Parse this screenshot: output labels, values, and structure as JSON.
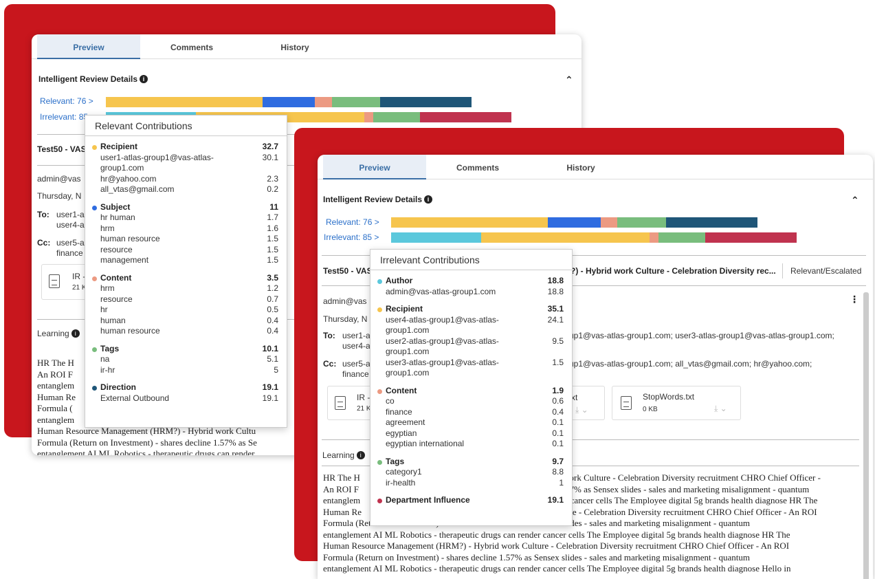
{
  "colors": {
    "accent_red": "#c8161d",
    "link_blue": "#2a6fc9",
    "yellow": "#f6c54e",
    "blue": "#2f6ce0",
    "salmon": "#ec9a82",
    "green": "#79bd7d",
    "navy": "#1f5678",
    "cyan": "#5bc8dc",
    "crimson": "#c0334f"
  },
  "back": {
    "tabs": [
      "Preview",
      "Comments",
      "History"
    ],
    "review_title": "Intelligent Review Details",
    "relevant": "Relevant: 76 >",
    "irrelevant": "Irrelevant: 85 >",
    "subject": "Test50 - VAS",
    "sender": "admin@vas",
    "date": "Thursday, N",
    "to_label": "To:",
    "to_line1": "user1-a",
    "to_line2": "user4-a",
    "cc_label": "Cc:",
    "cc_line1": "user5-a",
    "cc_line2": "finance",
    "attach_name": "IR -",
    "attach_size": "21 K",
    "learning": "Learning",
    "body": [
      "HR The H",
      "An ROI F",
      "entanglem",
      "Human Re",
      "Formula (",
      "entanglem",
      "Human Resource Management (HRM?) - Hybrid work Cultu",
      "Formula (Return on Investment) - shares decline 1.57% as Se",
      "entanglement AI ML Robotics - therapeutic drugs can render"
    ],
    "popup": {
      "title": "Relevant Contributions",
      "groups": [
        {
          "name": "Recipient",
          "value": "32.7",
          "color": "#f6c54e",
          "items": [
            {
              "label": "user1-atlas-group1@vas-atlas-",
              "value": "30.1"
            },
            {
              "label": "group1.com",
              "value": ""
            },
            {
              "label": "hr@yahoo.com",
              "value": "2.3"
            },
            {
              "label": "all_vtas@gmail.com",
              "value": "0.2"
            }
          ]
        },
        {
          "name": "Subject",
          "value": "11",
          "color": "#2f6ce0",
          "items": [
            {
              "label": "hr human",
              "value": "1.7"
            },
            {
              "label": "hrm",
              "value": "1.6"
            },
            {
              "label": "human resource",
              "value": "1.5"
            },
            {
              "label": "resource",
              "value": "1.5"
            },
            {
              "label": "management",
              "value": "1.5"
            }
          ]
        },
        {
          "name": "Content",
          "value": "3.5",
          "color": "#ec9a82",
          "items": [
            {
              "label": "hrm",
              "value": "1.2"
            },
            {
              "label": "resource",
              "value": "0.7"
            },
            {
              "label": "hr",
              "value": "0.5"
            },
            {
              "label": "human",
              "value": "0.4"
            },
            {
              "label": "human resource",
              "value": "0.4"
            }
          ]
        },
        {
          "name": "Tags",
          "value": "10.1",
          "color": "#79bd7d",
          "items": [
            {
              "label": "na",
              "value": "5.1"
            },
            {
              "label": "ir-hr",
              "value": "5"
            }
          ]
        },
        {
          "name": "Direction",
          "value": "19.1",
          "color": "#1f5678",
          "items": [
            {
              "label": "External Outbound",
              "value": "19.1"
            }
          ]
        }
      ]
    }
  },
  "front": {
    "tabs": [
      "Preview",
      "Comments",
      "History"
    ],
    "review_title": "Intelligent Review Details",
    "relevant": "Relevant: 76 >",
    "irrelevant": "Irrelevant: 85 >",
    "subject_left": "Test50 - VAS",
    "subject_right": "?) - Hybrid work Culture - Celebration Diversity rec...",
    "status": "Relevant/Escalated",
    "more_icon": "⋮",
    "sender": "admin@vas",
    "date": "Thursday, N",
    "to_label": "To:",
    "to_line1": "user1-a",
    "to_line2": "user4-a",
    "to_right": "up1@vas-atlas-group1.com; user3-atlas-group1@vas-atlas-group1.com;",
    "cc_label": "Cc:",
    "cc_line1": "user5-a",
    "cc_line2": "finance",
    "cc_right": "up1@vas-atlas-group1.com; all_vtas@gmail.com; hr@yahoo.com;",
    "attach1_name": "IR -",
    "attach1_size": "21 K",
    "attach2_name": "xt",
    "attach3_name": "StopWords.txt",
    "attach3_size": "0 KB",
    "learning": "Learning",
    "body_left": [
      "HR The H",
      "An ROI F",
      "entanglem",
      "Human Re"
    ],
    "body_right": [
      "vork Culture - Celebration Diversity recruitment CHRO Chief Officer -",
      "57% as Sensex slides - sales and marketing misalignment - quantum",
      "r cancer cells The Employee digital 5g brands health diagnose HR The",
      "ure - Celebration Diversity recruitment CHRO Chief Officer - An ROI"
    ],
    "body_full": [
      "Formula (Return on Investment) - shares decline 1.57% as Sensex slides - sales and marketing misalignment - quantum",
      "entanglement AI ML Robotics - therapeutic drugs can render cancer cells The Employee digital 5g brands health diagnose HR The",
      "Human Resource Management (HRM?) - Hybrid work Culture - Celebration Diversity recruitment CHRO Chief Officer - An ROI",
      "Formula (Return on Investment) - shares decline 1.57% as Sensex slides - sales and marketing misalignment - quantum",
      "entanglement AI ML Robotics - therapeutic drugs can render cancer cells The Employee digital 5g brands health diagnose Hello in"
    ],
    "popup": {
      "title": "Irrelevant Contributions",
      "groups": [
        {
          "name": "Author",
          "value": "18.8",
          "color": "#5bc8dc",
          "items": [
            {
              "label": "admin@vas-atlas-group1.com",
              "value": "18.8"
            }
          ]
        },
        {
          "name": "Recipient",
          "value": "35.1",
          "color": "#f6c54e",
          "items": [
            {
              "label": "user4-atlas-group1@vas-atlas-",
              "value": "24.1"
            },
            {
              "label": "group1.com",
              "value": ""
            },
            {
              "label": "user2-atlas-group1@vas-atlas-",
              "value": "9.5"
            },
            {
              "label": "group1.com",
              "value": ""
            },
            {
              "label": "user3-atlas-group1@vas-atlas-",
              "value": "1.5"
            },
            {
              "label": "group1.com",
              "value": ""
            }
          ]
        },
        {
          "name": "Content",
          "value": "1.9",
          "color": "#ec9a82",
          "items": [
            {
              "label": "co",
              "value": "0.6"
            },
            {
              "label": "finance",
              "value": "0.4"
            },
            {
              "label": "agreement",
              "value": "0.1"
            },
            {
              "label": "egyptian",
              "value": "0.1"
            },
            {
              "label": "egyptian international",
              "value": "0.1"
            }
          ]
        },
        {
          "name": "Tags",
          "value": "9.7",
          "color": "#79bd7d",
          "items": [
            {
              "label": "category1",
              "value": "8.8"
            },
            {
              "label": "ir-health",
              "value": "1"
            }
          ]
        },
        {
          "name": "Department Influence",
          "value": "19.1",
          "color": "#c0334f",
          "items": []
        }
      ]
    }
  },
  "bars": {
    "relevant": [
      {
        "name": "Recipient",
        "value": 32.7,
        "color": "#f6c54e"
      },
      {
        "name": "Subject",
        "value": 11,
        "color": "#2f6ce0"
      },
      {
        "name": "Content",
        "value": 3.5,
        "color": "#ec9a82"
      },
      {
        "name": "Tags",
        "value": 10.1,
        "color": "#79bd7d"
      },
      {
        "name": "Direction",
        "value": 19.1,
        "color": "#1f5678"
      }
    ],
    "irrelevant": [
      {
        "name": "Author",
        "value": 18.8,
        "color": "#5bc8dc"
      },
      {
        "name": "Recipient",
        "value": 35.1,
        "color": "#f6c54e"
      },
      {
        "name": "Content",
        "value": 1.9,
        "color": "#ec9a82"
      },
      {
        "name": "Tags",
        "value": 9.7,
        "color": "#79bd7d"
      },
      {
        "name": "Department Influence",
        "value": 19.1,
        "color": "#c0334f"
      }
    ]
  }
}
